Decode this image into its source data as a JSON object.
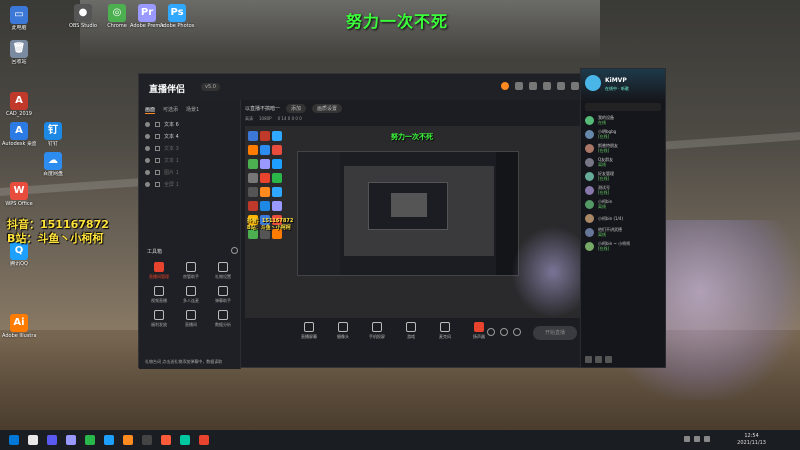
{
  "overlay": {
    "title": "努力一次不死",
    "douyin": "抖音：151167872",
    "bilibili": "B站：斗鱼丶小柯柯"
  },
  "desktop_icons": [
    {
      "label": "此电脑",
      "color": "#3b78d8",
      "glyph": "▭"
    },
    {
      "label": "回收站",
      "color": "#7a8aa0",
      "glyph": "🗑"
    },
    {
      "label": "CAD_2019",
      "color": "#c0392b",
      "glyph": "A"
    },
    {
      "label": "Autodesk 桌面应用",
      "color": "#2c7be5",
      "glyph": "A"
    },
    {
      "label": "钉钉",
      "color": "#1e88e5",
      "glyph": "钉"
    },
    {
      "label": "百度网盘",
      "color": "#2d8cf0",
      "glyph": "☁"
    },
    {
      "label": "WPS Office",
      "color": "#e74c3c",
      "glyph": "W"
    },
    {
      "label": "腾讯QQ",
      "color": "#1ea0ff",
      "glyph": "Q"
    },
    {
      "label": "Adobe Illustrator",
      "color": "#ff7c00",
      "glyph": "Ai"
    },
    {
      "label": "Adobe Photoshop",
      "color": "#31a8ff",
      "glyph": "Ps"
    },
    {
      "label": "Adobe Premiere",
      "color": "#9999ff",
      "glyph": "Pr"
    },
    {
      "label": "Chrome",
      "color": "#4caf50",
      "glyph": "◎"
    },
    {
      "label": "OBS Studio",
      "color": "#555555",
      "glyph": "●"
    }
  ],
  "app": {
    "logo": "直播伴侣",
    "version": "v5.0",
    "left_tabs": [
      "画面",
      "可选添",
      "场景1"
    ],
    "scene_items": [
      "文本 6",
      "文本 4",
      "文本 3",
      "文本 1",
      "图片 1",
      "全屏 1"
    ],
    "tools_label": "工具箱",
    "tools": [
      {
        "label": "直播间管理",
        "red": true
      },
      {
        "label": "房管助手",
        "red": false
      },
      {
        "label": "礼物设置",
        "red": false
      },
      {
        "label": "视频直播",
        "red": false
      },
      {
        "label": "多人连麦",
        "red": false
      },
      {
        "label": "弹幕助手",
        "red": false
      },
      {
        "label": "福利发放",
        "red": false
      },
      {
        "label": "直播间",
        "red": false
      },
      {
        "label": "数据分析",
        "red": false
      }
    ],
    "bottom_note": "礼物台词  点击送礼物添加弹幕中，数据读取",
    "stage_title": "以直播不搞暗一",
    "stage_pill": "添加",
    "stage_pill2": "画质设置",
    "stage_sub": [
      "高清",
      "1080P",
      "0 14 0 0 0 0"
    ],
    "stage_overlay_title": "努力一次不死",
    "stage_social1": "抖音：151167872",
    "stage_social2": "B站：斗鱼丶小柯柯",
    "bottom_actions": [
      {
        "label": "直播屏幕",
        "red": false
      },
      {
        "label": "摄像头",
        "red": false
      },
      {
        "label": "手机投屏",
        "red": false
      },
      {
        "label": "游戏",
        "red": false
      },
      {
        "label": "麦克风",
        "red": false
      },
      {
        "label": "扬声器",
        "red": true
      }
    ],
    "start_live": "开始直播"
  },
  "chat": {
    "name": "KiMVP",
    "sub": "在线中 · 听歌",
    "items": [
      {
        "name": "我的设备",
        "sub": "在线"
      },
      {
        "name": "小明bgbg",
        "sub": "[在线]"
      },
      {
        "name": "斯普特朋友",
        "sub": "[在线]"
      },
      {
        "name": "Q友群友",
        "sub": "离线"
      },
      {
        "name": "好友管理",
        "sub": "[在线]"
      },
      {
        "name": "测试号",
        "sub": "[在线]"
      },
      {
        "name": "小柯bin",
        "sub": "离线"
      },
      {
        "name": "小柯bin (1/4)",
        "sub": ""
      },
      {
        "name": "他们不讲武德",
        "sub": "离线"
      },
      {
        "name": "小柯bin ~ 小柯柯",
        "sub": "[在线]"
      }
    ]
  },
  "taskbar": {
    "time": "12:54",
    "date": "2021/11/13",
    "apps": [
      "#0078d7",
      "#e8e8e8",
      "#5a5af0",
      "#9999ff",
      "#2bb84a",
      "#1ea0ff",
      "#ff8a1f",
      "#444444",
      "#ff5b3a",
      "#00c8a0",
      "#e8432c"
    ]
  }
}
